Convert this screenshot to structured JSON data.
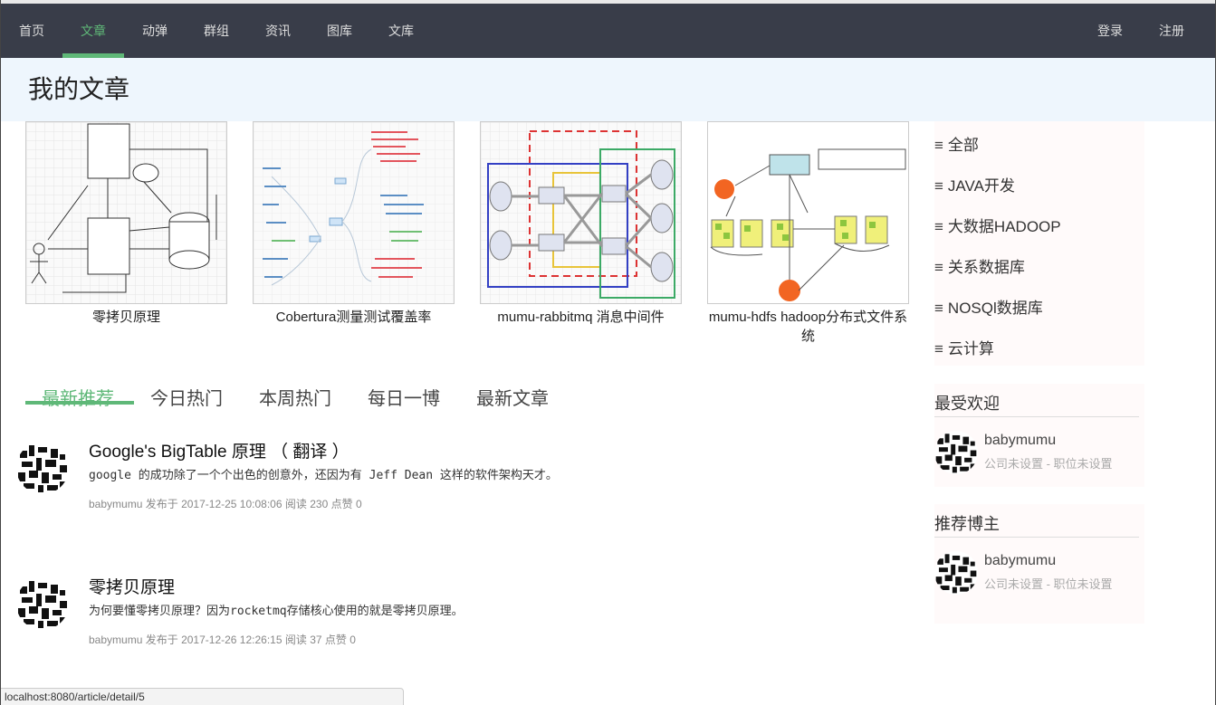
{
  "nav": {
    "items": [
      "首页",
      "文章",
      "动弹",
      "群组",
      "资讯",
      "图库",
      "文库"
    ],
    "login": "登录",
    "register": "注册",
    "accent": "#5fb878",
    "bg": "#393d49"
  },
  "page": {
    "title": "我的文章"
  },
  "featured": [
    {
      "caption": "零拷贝原理"
    },
    {
      "caption": "Cobertura测量测试覆盖率"
    },
    {
      "caption": "mumu-rabbitmq 消息中间件"
    },
    {
      "caption": "mumu-hdfs hadoop分布式文件系统"
    }
  ],
  "tabs": [
    "最新推荐",
    "今日热门",
    "本周热门",
    "每日一博",
    "最新文章"
  ],
  "articles": [
    {
      "title": "Google's BigTable 原理 （ 翻译 ）",
      "desc": "google 的成功除了一个个出色的创意外，还因为有 Jeff Dean 这样的软件架构天才。",
      "author": "babymumu",
      "published_label": "发布于",
      "date": "2017-12-25 10:08:06",
      "read_label": "阅读",
      "reads": "230",
      "like_label": "点赞",
      "likes": "0"
    },
    {
      "title": "零拷贝原理",
      "desc": "为何要懂零拷贝原理？因为rocketmq存储核心使用的就是零拷贝原理。",
      "author": "babymumu",
      "published_label": "发布于",
      "date": "2017-12-26 12:26:15",
      "read_label": "阅读",
      "reads": "37",
      "like_label": "点赞",
      "likes": "0"
    }
  ],
  "categories": [
    "全部",
    "JAVA开发",
    "大数据HADOOP",
    "关系数据库",
    "NOSQl数据库",
    "云计算"
  ],
  "popular": {
    "title": "最受欢迎",
    "user": {
      "name": "babymumu",
      "info": "公司未设置 - 职位未设置"
    }
  },
  "recommended": {
    "title": "推荐博主",
    "user": {
      "name": "babymumu",
      "info": "公司未设置 - 职位未设置"
    }
  },
  "status": {
    "url": "localhost:8080/article/detail/5"
  }
}
